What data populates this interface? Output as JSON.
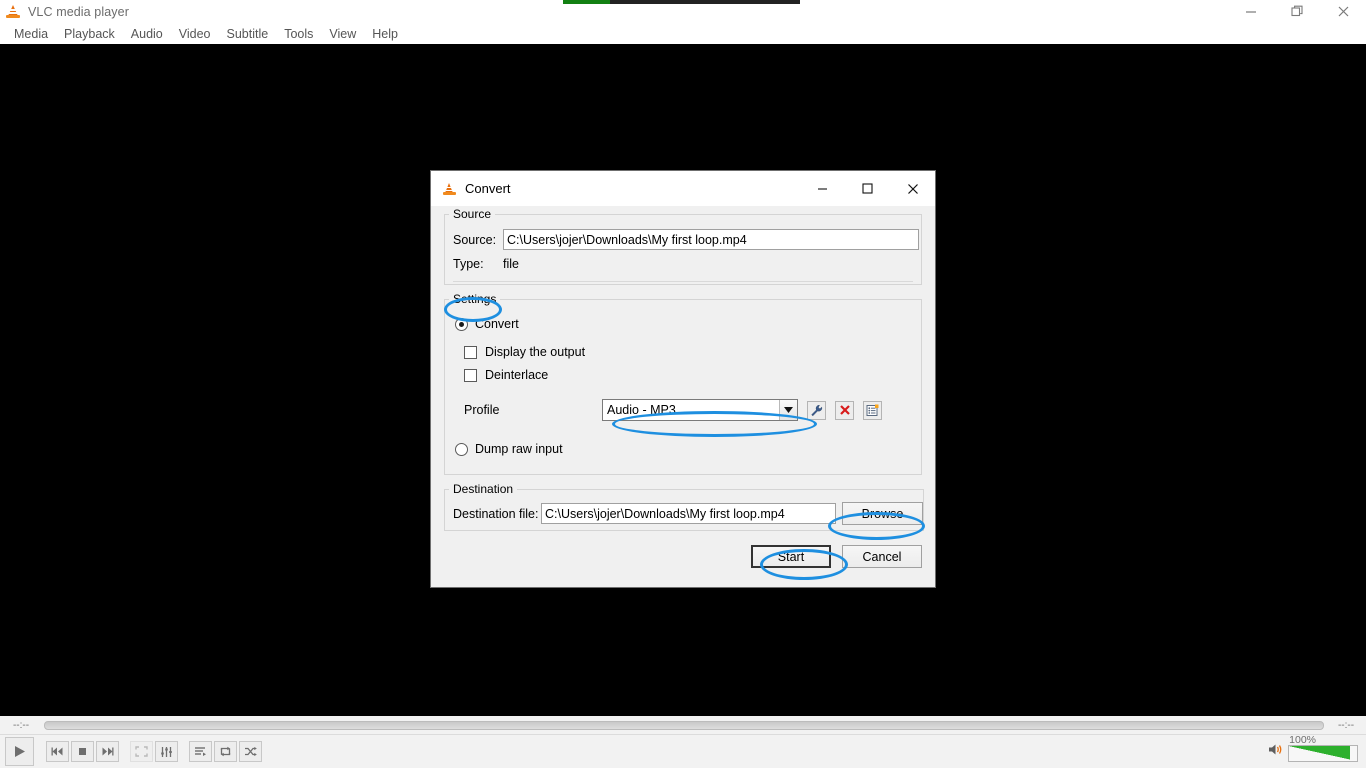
{
  "app": {
    "title": "VLC media player",
    "icon": "vlc-cone-icon",
    "menu": [
      "Media",
      "Playback",
      "Audio",
      "Video",
      "Subtitle",
      "Tools",
      "View",
      "Help"
    ],
    "window_controls": [
      "minimize-icon",
      "restore-icon",
      "close-icon"
    ]
  },
  "player": {
    "time_elapsed": "--:--",
    "time_total": "--:--",
    "volume_label": "100%",
    "volume_percent": 100,
    "controls": [
      {
        "name": "play-button",
        "icon": "play-icon",
        "enabled": true
      },
      {
        "name": "previous-button",
        "icon": "previous-icon",
        "enabled": true
      },
      {
        "name": "stop-button",
        "icon": "stop-icon",
        "enabled": true
      },
      {
        "name": "next-button",
        "icon": "next-icon",
        "enabled": true
      },
      {
        "name": "fullscreen-button",
        "icon": "fullscreen-icon",
        "enabled": false
      },
      {
        "name": "equalizer-button",
        "icon": "equalizer-icon",
        "enabled": true
      },
      {
        "name": "playlist-button",
        "icon": "playlist-icon",
        "enabled": true
      },
      {
        "name": "loop-button",
        "icon": "loop-icon",
        "enabled": true
      },
      {
        "name": "shuffle-button",
        "icon": "shuffle-icon",
        "enabled": true
      }
    ]
  },
  "dialog": {
    "title": "Convert",
    "icon": "vlc-cone-icon",
    "window_controls": [
      "minimize-icon",
      "maximize-icon",
      "close-icon"
    ],
    "source": {
      "legend": "Source",
      "source_label": "Source:",
      "source_value": "C:\\Users\\jojer\\Downloads\\My first loop.mp4",
      "type_label": "Type:",
      "type_value": "file"
    },
    "settings": {
      "legend": "Settings",
      "convert_label": "Convert",
      "convert_selected": true,
      "display_output_label": "Display the output",
      "display_output_checked": false,
      "deinterlace_label": "Deinterlace",
      "deinterlace_checked": false,
      "profile_label": "Profile",
      "profile_value": "Audio - MP3",
      "profile_edit_icon": "wrench-icon",
      "profile_delete_icon": "red-x-icon",
      "profile_new_icon": "new-profile-icon",
      "dump_raw_label": "Dump raw input",
      "dump_raw_selected": false
    },
    "destination": {
      "legend": "Destination",
      "dest_label": "Destination file:",
      "dest_value": "C:\\Users\\jojer\\Downloads\\My first loop.mp4",
      "browse_label": "Browse"
    },
    "actions": {
      "start_label": "Start",
      "cancel_label": "Cancel"
    }
  },
  "annotations": {
    "color": "#1e8fe0",
    "targets": [
      "settings-legend",
      "profile-combo",
      "browse-button",
      "start-button"
    ]
  }
}
